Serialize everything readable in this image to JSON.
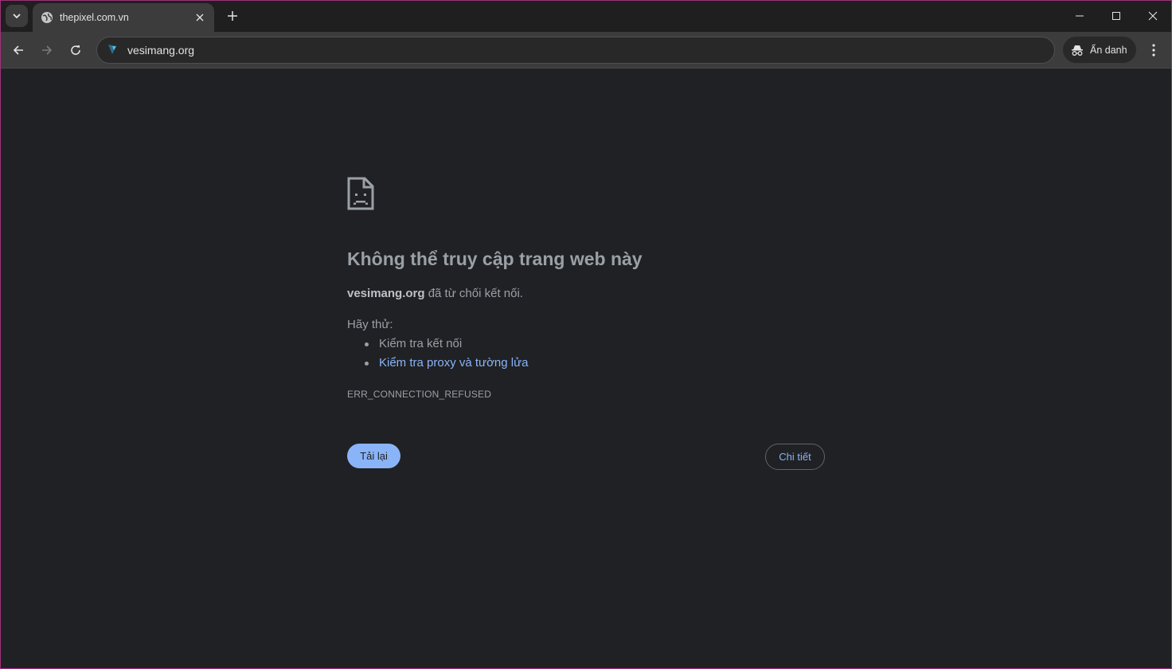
{
  "browser": {
    "tab": {
      "title": "thepixel.com.vn",
      "favicon": "globe-icon"
    },
    "new_tab_icon": "plus-icon",
    "window_controls": [
      "minimize-icon",
      "maximize-icon",
      "close-icon"
    ],
    "toolbar": {
      "back_icon": "arrow-left-icon",
      "forward_icon": "arrow-right-icon",
      "reload_icon": "reload-icon",
      "url": "vesimang.org",
      "incognito_label": "Ẩn danh",
      "menu_icon": "kebab-menu-icon"
    }
  },
  "error_page": {
    "title": "Không thể truy cập trang web này",
    "host": "vesimang.org",
    "desc_suffix": " đã từ chối kết nối.",
    "try_label": "Hãy thử:",
    "suggestions": {
      "check_connection": "Kiểm tra kết nối",
      "check_proxy": "Kiểm tra proxy và tường lửa"
    },
    "error_code": "ERR_CONNECTION_REFUSED",
    "reload_label": "Tải lại",
    "details_label": "Chi tiết"
  },
  "colors": {
    "page_bg": "#202124",
    "accent": "#8ab4f8",
    "text_muted": "#9aa0a6"
  }
}
